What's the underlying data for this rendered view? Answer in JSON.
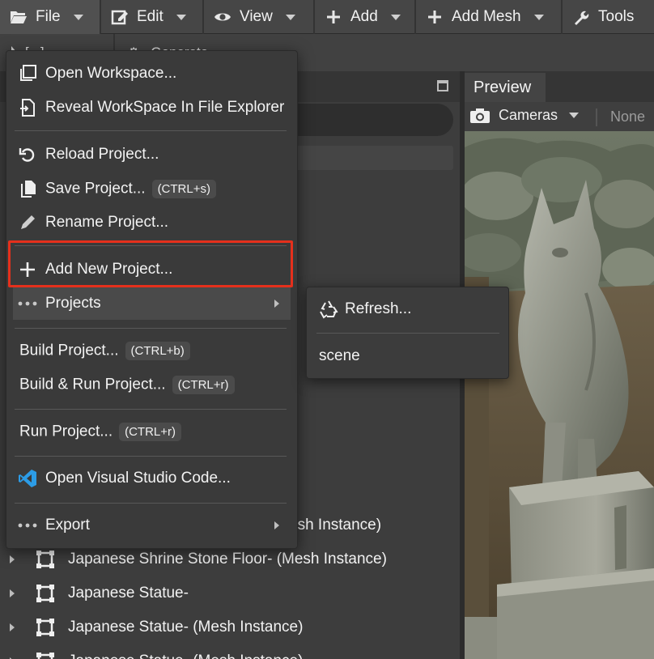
{
  "menubar": {
    "items": [
      {
        "label": "File",
        "icon": "folder-open-icon"
      },
      {
        "label": "Edit",
        "icon": "edit-icon"
      },
      {
        "label": "View",
        "icon": "eye-icon"
      },
      {
        "label": "Add",
        "icon": "plus-icon"
      },
      {
        "label": "Add Mesh",
        "icon": "plus-icon"
      },
      {
        "label": "Tools",
        "icon": "wrench-icon"
      }
    ]
  },
  "toolbar2": {
    "item1": "[...]",
    "item2": "Generate"
  },
  "preview": {
    "tab_label": "Preview",
    "cameras_label": "Cameras",
    "none_label": "None"
  },
  "file_menu": {
    "items": [
      {
        "label": "Open Workspace...",
        "icon": "window-stack-icon"
      },
      {
        "label": "Reveal WorkSpace In File Explorer",
        "icon": "reveal-file-icon"
      },
      {
        "label": "Reload Project...",
        "icon": "reload-icon"
      },
      {
        "label": "Save Project...",
        "shortcut": "(CTRL+s)",
        "icon": "copy-icon"
      },
      {
        "label": "Rename Project...",
        "icon": "pencil-icon"
      },
      {
        "label": "Add New Project...",
        "icon": "plus-icon"
      },
      {
        "label": "Projects",
        "icon": "more-dots-icon"
      },
      {
        "label": "Build Project...",
        "shortcut": "(CTRL+b)"
      },
      {
        "label": "Build & Run Project...",
        "shortcut": "(CTRL+r)"
      },
      {
        "label": "Run Project...",
        "shortcut": "(CTRL+r)"
      },
      {
        "label": "Open Visual Studio Code...",
        "icon": "vscode-icon"
      },
      {
        "label": "Export",
        "icon": "more-dots-icon"
      }
    ]
  },
  "projects_submenu": {
    "items": [
      {
        "label": "Refresh...",
        "icon": "recycle-icon"
      },
      {
        "label": "scene"
      }
    ]
  },
  "outliner": {
    "rows": [
      {
        "label": "esh Instance)"
      },
      {
        "label": "Japanese Shrine Stone Floor- (Mesh Instance)"
      },
      {
        "label": "Japanese Statue-"
      },
      {
        "label": "Japanese Statue- (Mesh Instance)"
      },
      {
        "label": "Japanese Statue- (Mesh Instance)"
      }
    ]
  },
  "colors": {
    "highlight": "#e5301c",
    "vscode_blue": "#2c9ce6"
  }
}
